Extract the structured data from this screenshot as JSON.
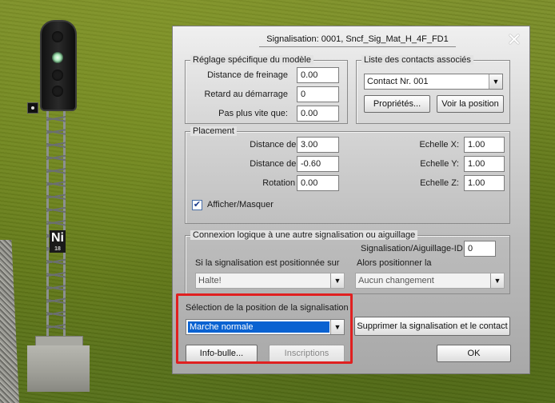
{
  "dialog": {
    "title": "Signalisation: 0001, Sncf_Sig_Mat_H_4F_FD1",
    "close_glyph": "✕"
  },
  "model": {
    "legend": "Réglage spécifique du modèle",
    "braking_label": "Distance de freinage",
    "braking_value": "0.00",
    "start_delay_label": "Retard au démarrage",
    "start_delay_value": "0",
    "max_speed_label": "Pas plus vite que:",
    "max_speed_value": "0.00"
  },
  "contacts": {
    "legend": "Liste des contacts associés",
    "selected": "Contact Nr. 001",
    "properties_button": "Propriétés...",
    "view_button": "Voir la position"
  },
  "placement": {
    "legend": "Placement",
    "dist1_label": "Distance de la",
    "dist1_value": "3.00",
    "dist2_label": "Distance de la",
    "dist2_value": "-0.60",
    "rotz_label": "Rotation Z:",
    "rotz_value": "0.00",
    "scalex_label": "Echelle X:",
    "scalex_value": "1.00",
    "scaley_label": "Echelle Y:",
    "scaley_value": "1.00",
    "scalez_label": "Echelle Z:",
    "scalez_value": "1.00",
    "show_hide_label": "Afficher/Masquer",
    "show_hide_checked": true,
    "check_glyph": "✔"
  },
  "logic": {
    "legend": "Connexion logique à une autre signalisation ou aiguillage",
    "id_label": "Signalisation/Aiguillage-ID",
    "id_value": "0",
    "if_label": "Si la signalisation est positionnée sur",
    "if_value": "Halte!",
    "then_label": "Alors positionner la",
    "then_value": "Aucun changement"
  },
  "position": {
    "label": "Sélection de la position de la signalisation",
    "selected": "Marche normale",
    "delete_button": "Supprimer la signalisation et le contact"
  },
  "footer": {
    "tooltip_button": "Info-bulle...",
    "inscriptions_button": "Inscriptions",
    "ok_button": "OK"
  },
  "scene": {
    "mast_sign_text": "Ni",
    "mast_sign_small": "18"
  },
  "colors": {
    "highlight": "#e02020",
    "selection": "#0a62d1"
  },
  "icons": {
    "combo_arrow": "▼"
  }
}
